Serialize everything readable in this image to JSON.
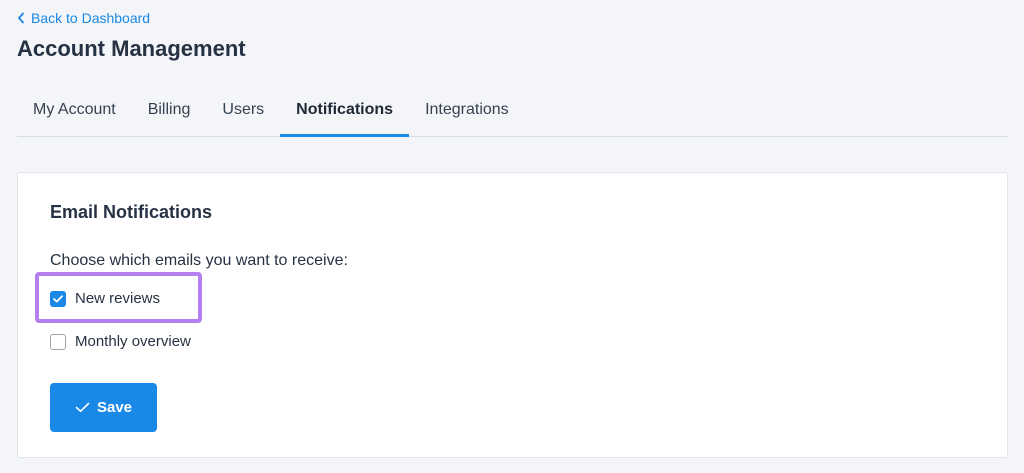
{
  "header": {
    "back_link": "Back to Dashboard",
    "title": "Account Management"
  },
  "tabs": [
    {
      "label": "My Account",
      "active": false
    },
    {
      "label": "Billing",
      "active": false
    },
    {
      "label": "Users",
      "active": false
    },
    {
      "label": "Notifications",
      "active": true
    },
    {
      "label": "Integrations",
      "active": false
    }
  ],
  "card": {
    "title": "Email Notifications",
    "description": "Choose which emails you want to receive:",
    "options": [
      {
        "label": "New reviews",
        "checked": true
      },
      {
        "label": "Monthly overview",
        "checked": false
      }
    ],
    "save_label": "Save"
  },
  "colors": {
    "accent": "#1a88e6",
    "highlight": "#b57ff0",
    "page_background": "#f3f5f8",
    "card_background": "#ffffff",
    "title_text": "#263244"
  },
  "icons": {
    "back": "chevron-left-icon",
    "checkbox_checked": "checkmark-icon",
    "save": "check-icon"
  }
}
